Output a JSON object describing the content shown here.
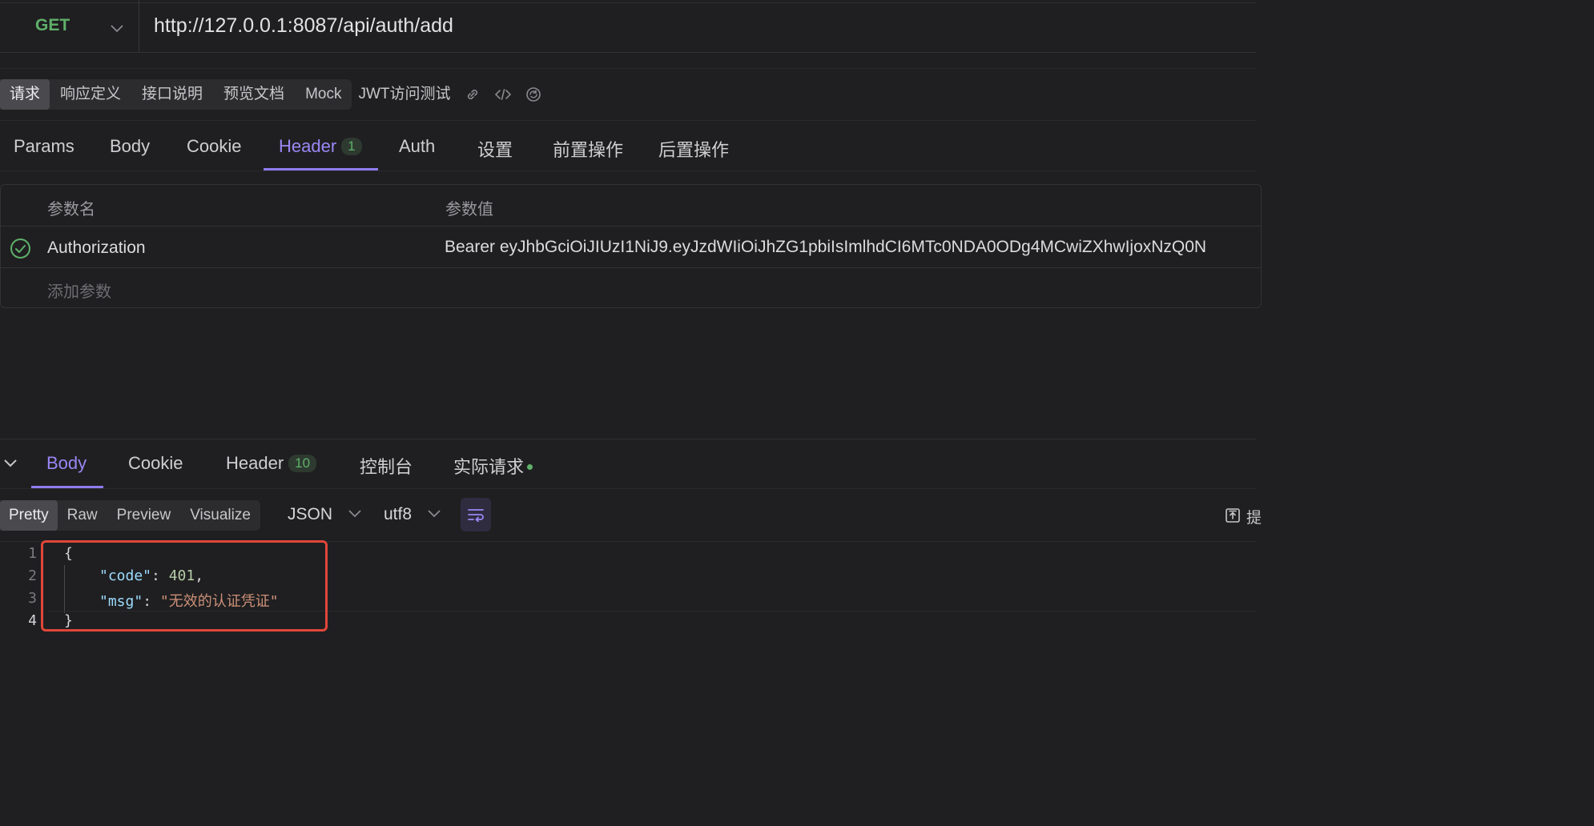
{
  "request": {
    "method": "GET",
    "url": "http://127.0.0.1:8087/api/auth/add"
  },
  "top_tabs": {
    "items": [
      "请求",
      "响应定义",
      "接口说明",
      "预览文档",
      "Mock"
    ],
    "extra": "JWT访问测试",
    "icons": [
      "link-icon",
      "code-icon",
      "sync-icon"
    ]
  },
  "req_tabs": {
    "params": "Params",
    "body": "Body",
    "cookie": "Cookie",
    "header": "Header",
    "header_count": "1",
    "auth": "Auth",
    "settings": "设置",
    "pre": "前置操作",
    "post": "后置操作",
    "active": "Header"
  },
  "headers_table": {
    "col_name": "参数名",
    "col_value": "参数值",
    "rows": [
      {
        "enabled": true,
        "name": "Authorization",
        "value": "Bearer eyJhbGciOiJIUzI1NiJ9.eyJzdWIiOiJhZG1pbiIsImlhdCI6MTc0NDA0ODg4MCwiZXhwIjoxNzQ0N"
      }
    ],
    "add_placeholder": "添加参数"
  },
  "res_tabs": {
    "body": "Body",
    "cookie": "Cookie",
    "header": "Header",
    "header_count": "10",
    "console": "控制台",
    "actual": "实际请求",
    "active": "Body"
  },
  "format_bar": {
    "modes": [
      "Pretty",
      "Raw",
      "Preview",
      "Visualize"
    ],
    "active_mode": "Pretty",
    "type": "JSON",
    "encoding": "utf8",
    "right_label": "提"
  },
  "response_body": {
    "line_numbers": [
      "1",
      "2",
      "3",
      "4"
    ],
    "open_brace": "{",
    "close_brace": "}",
    "code_key": "\"code\"",
    "code_value": "401",
    "msg_key": "\"msg\"",
    "msg_value": "\"无效的认证凭证\""
  },
  "colors": {
    "accent": "#9b87f5",
    "method_green": "#5fb06a",
    "highlight_red": "#e0463a"
  }
}
